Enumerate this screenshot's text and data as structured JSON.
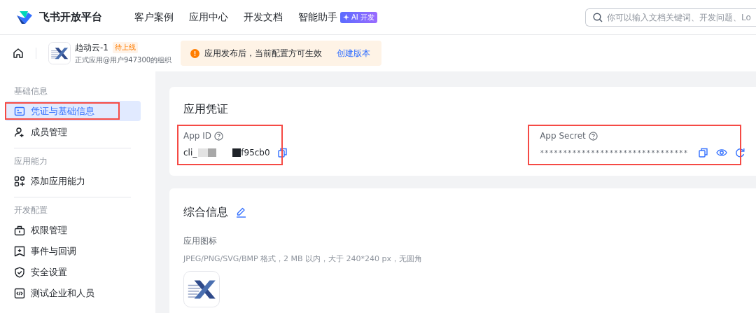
{
  "header": {
    "logo_text": "飞书开放平台",
    "nav": [
      {
        "label": "客户案例"
      },
      {
        "label": "应用中心"
      },
      {
        "label": "开发文档"
      },
      {
        "label": "智能助手",
        "badge": "AI 开发"
      }
    ],
    "search": {
      "placeholder": "你可以输入文档关键词、开发问题、Lo"
    }
  },
  "app_bar": {
    "app_name": "趋动云-1",
    "status": "待上线",
    "org": "正式应用@用户947300的组织",
    "notice": {
      "text": "应用发布后，当前配置方可生效",
      "action": "创建版本"
    }
  },
  "sidebar": {
    "groups": [
      {
        "title": "基础信息",
        "items": [
          {
            "label": "凭证与基础信息",
            "selected": true,
            "annotated": true
          },
          {
            "label": "成员管理",
            "selected": false
          }
        ]
      },
      {
        "title": "应用能力",
        "items": [
          {
            "label": "添加应用能力",
            "selected": false
          }
        ]
      },
      {
        "title": "开发配置",
        "items": [
          {
            "label": "权限管理",
            "selected": false
          },
          {
            "label": "事件与回调",
            "selected": false
          },
          {
            "label": "安全设置",
            "selected": false
          },
          {
            "label": "测试企业和人员",
            "selected": false
          }
        ]
      }
    ]
  },
  "credentials": {
    "title": "应用凭证",
    "app_id": {
      "label": "App ID",
      "value_start": "cli_",
      "value_end": "f95cb0",
      "annotated": true
    },
    "app_secret": {
      "label": "App Secret",
      "value": "********************************",
      "annotated": true
    }
  },
  "general": {
    "title": "综合信息",
    "icon_label": "应用图标",
    "icon_hint": "JPEG/PNG/SVG/BMP 格式，2 MB 以内，大于 240*240 px，无圆角"
  }
}
